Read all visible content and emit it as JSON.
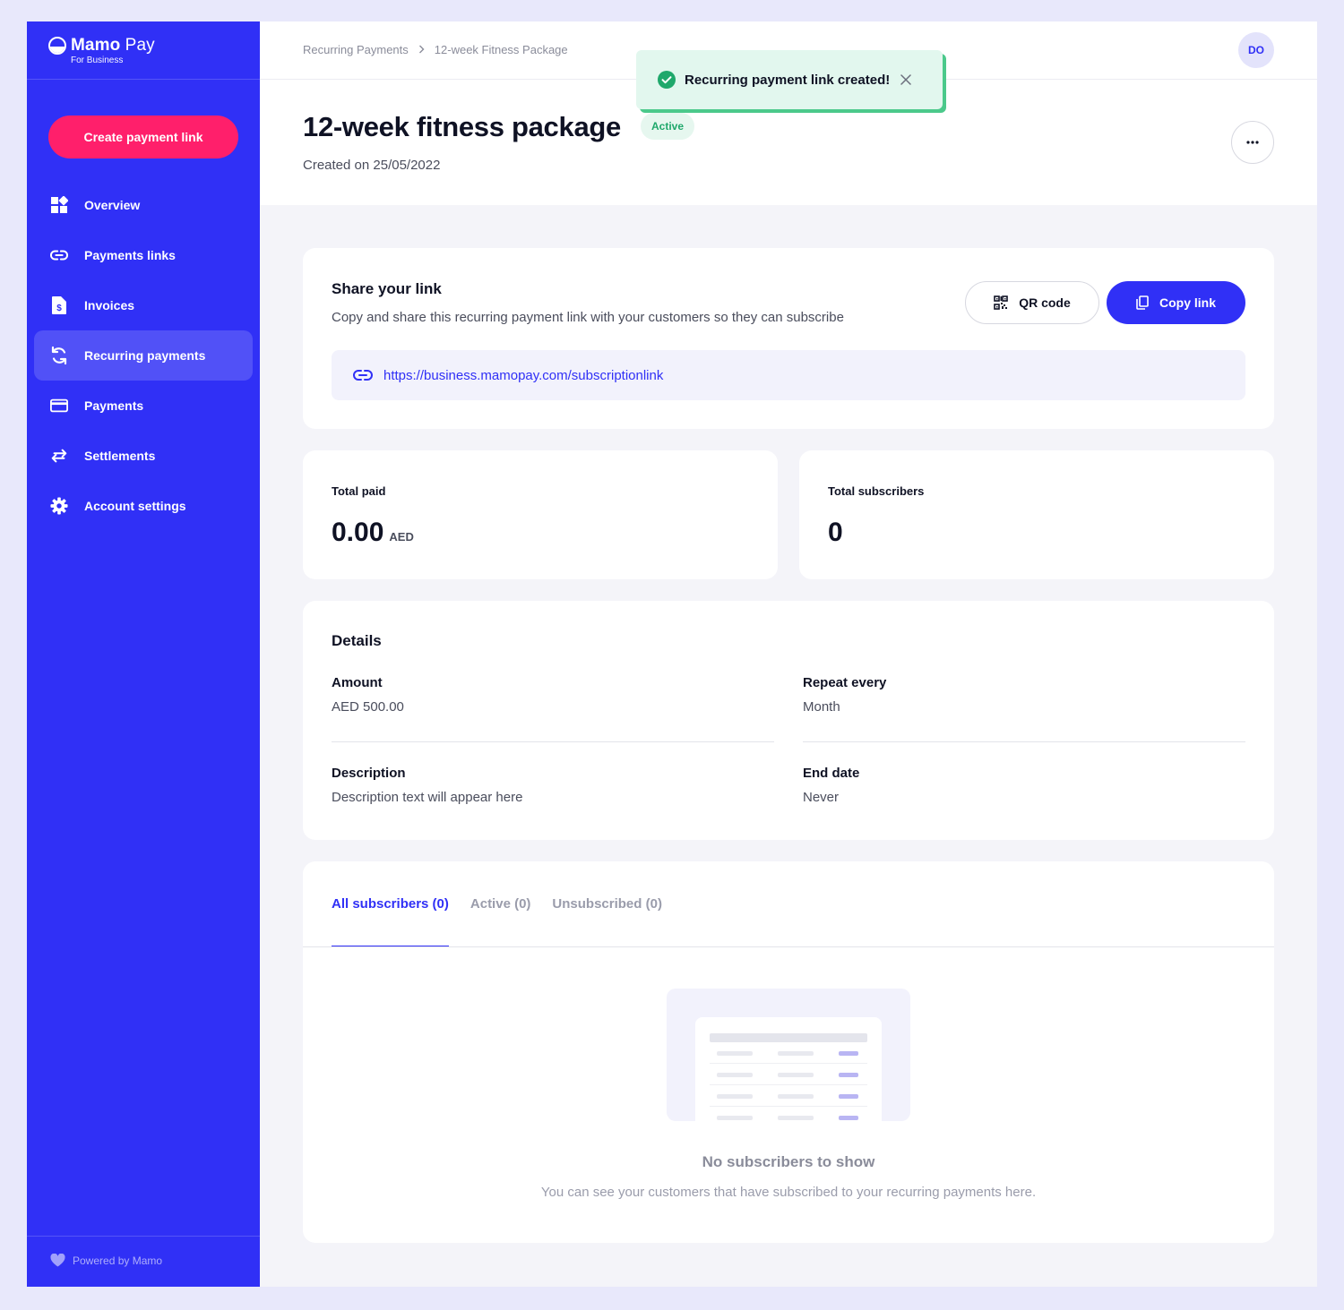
{
  "brand": {
    "name_bold": "Mamo",
    "name_light": " Pay",
    "subtitle": "For Business"
  },
  "sidebar": {
    "create_label": "Create payment link",
    "items": [
      {
        "label": "Overview",
        "icon": "grid-icon"
      },
      {
        "label": "Payments links",
        "icon": "link-icon"
      },
      {
        "label": "Invoices",
        "icon": "invoice-icon"
      },
      {
        "label": "Recurring payments",
        "icon": "recurring-icon",
        "active": true
      },
      {
        "label": "Payments",
        "icon": "card-icon"
      },
      {
        "label": "Settlements",
        "icon": "transfer-icon"
      },
      {
        "label": "Account settings",
        "icon": "gear-icon"
      }
    ],
    "footer": "Powered by Mamo"
  },
  "header": {
    "breadcrumb": [
      "Recurring Payments",
      "12-week Fitness Package"
    ],
    "avatar_initials": "DO",
    "title": "12-week fitness package",
    "status": "Active",
    "created": "Created on 25/05/2022"
  },
  "toast": {
    "message": "Recurring payment link created!"
  },
  "share": {
    "title": "Share your link",
    "description": "Copy and share this recurring payment link with your customers so they can subscribe",
    "qr_label": "QR code",
    "copy_label": "Copy link",
    "url": "https://business.mamopay.com/subscriptionlink"
  },
  "stats": {
    "total_paid_label": "Total paid",
    "total_paid_value": "0.00",
    "total_paid_unit": "AED",
    "total_subscribers_label": "Total subscribers",
    "total_subscribers_value": "0"
  },
  "details": {
    "title": "Details",
    "amount_label": "Amount",
    "amount_value": "AED 500.00",
    "repeat_label": "Repeat every",
    "repeat_value": "Month",
    "description_label": "Description",
    "description_value": "Description text will appear here",
    "end_label": "End date",
    "end_value": "Never"
  },
  "subscribers": {
    "tabs": [
      "All subscribers (0)",
      "Active (0)",
      "Unsubscribed (0)"
    ],
    "empty_title": "No subscribers to show",
    "empty_desc": "You can see your customers that have subscribed to your recurring payments here."
  },
  "colors": {
    "sidebar": "#3030f6",
    "primary": "#3030f6",
    "create_button": "#ff1f6b",
    "success": "#1fa86b",
    "toast_bg": "#e2f7ee"
  }
}
